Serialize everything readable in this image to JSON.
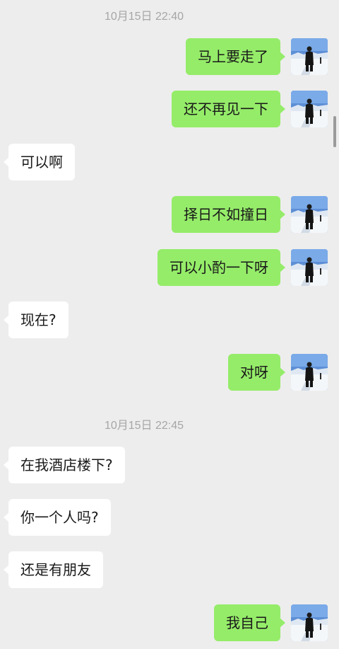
{
  "timestamps": [
    "10月15日 22:40",
    "10月15日 22:45"
  ],
  "messages": [
    {
      "side": "out",
      "text": "马上要走了"
    },
    {
      "side": "out",
      "text": "还不再见一下"
    },
    {
      "side": "in",
      "text": "可以啊"
    },
    {
      "side": "out",
      "text": "择日不如撞日"
    },
    {
      "side": "out",
      "text": "可以小酌一下呀"
    },
    {
      "side": "in",
      "text": "现在?"
    },
    {
      "side": "out",
      "text": "对呀"
    },
    {
      "side": "in",
      "text": "在我酒店楼下?"
    },
    {
      "side": "in",
      "text": "你一个人吗?"
    },
    {
      "side": "in",
      "text": "还是有朋友"
    },
    {
      "side": "out",
      "text": "我自己"
    }
  ],
  "colors": {
    "background": "#ededed",
    "incoming_bubble": "#ffffff",
    "outgoing_bubble": "#95ec69",
    "timestamp_text": "#a6a6a6"
  },
  "icons": {
    "avatar": "snow-landscape-person-avatar"
  }
}
